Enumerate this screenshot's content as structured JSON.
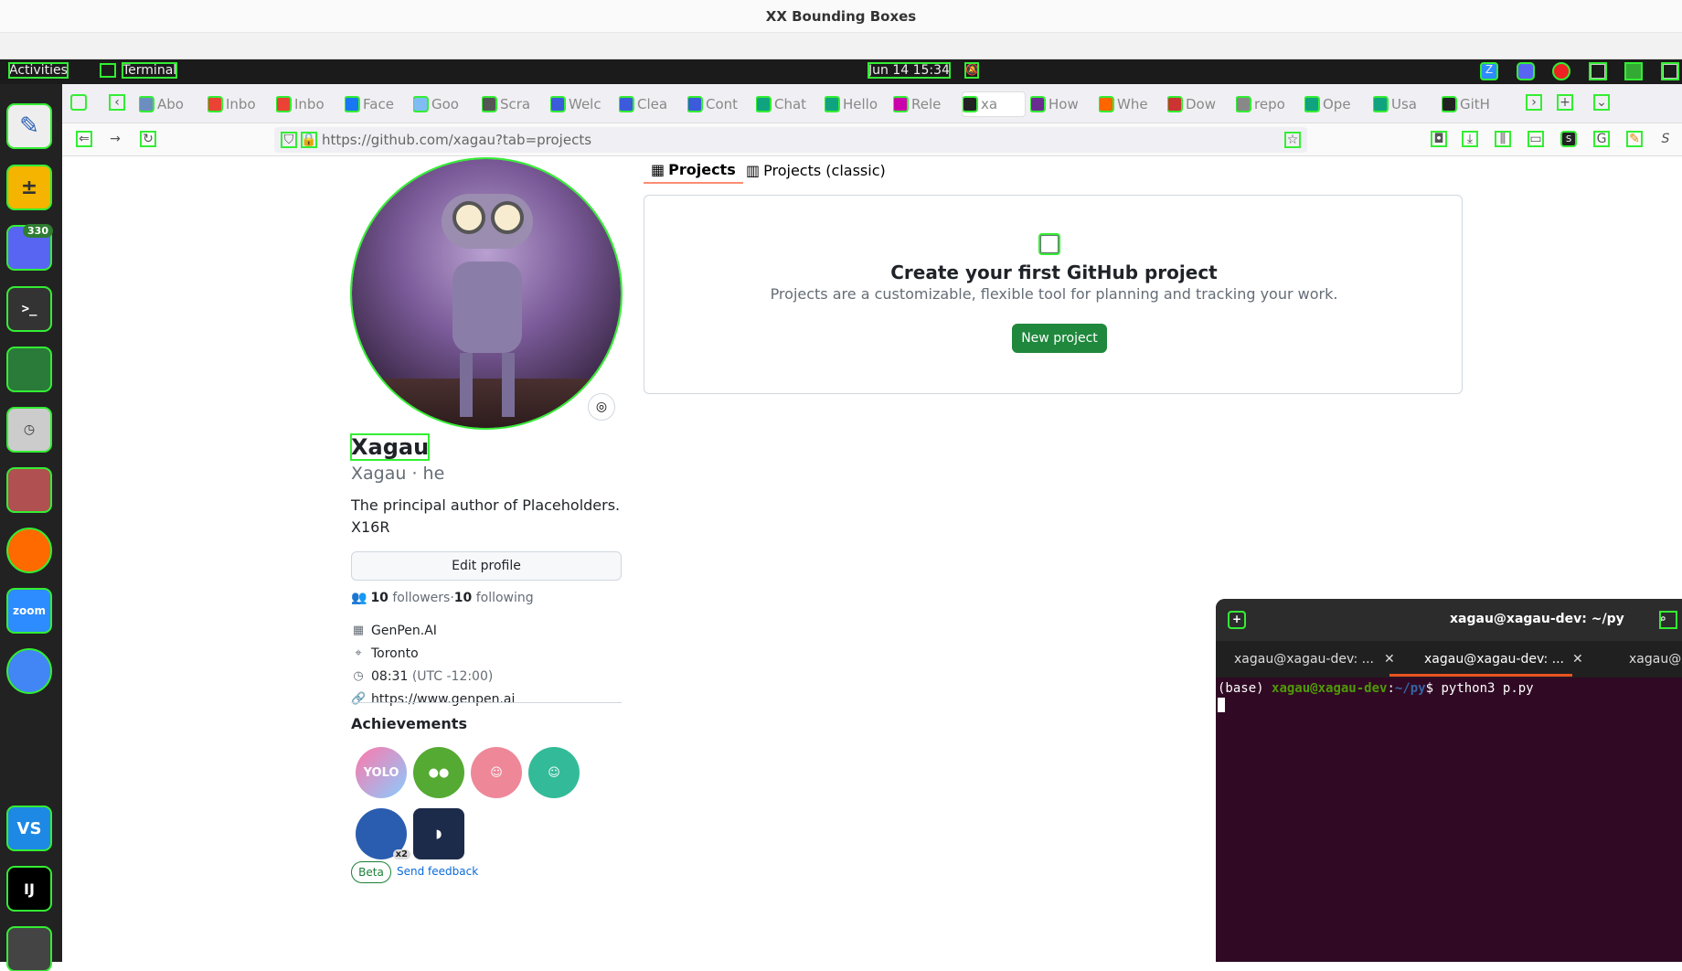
{
  "window": {
    "title": "XX Bounding Boxes"
  },
  "topbar": {
    "activities": "Activities",
    "app": "Terminal",
    "datetime": "Jun 14  15:34"
  },
  "dock": {
    "discord_badge": "330",
    "zoom": "zoom",
    "vs": "VS",
    "ij": "IJ"
  },
  "browser": {
    "tabs": [
      "Abo",
      "Inbo",
      "Inbo",
      "Face",
      "Goo",
      "Scra",
      "Welc",
      "Clea",
      "Cont",
      "Chat",
      "Hello",
      "Rele",
      "xa",
      "How",
      "Whe",
      "Dow",
      "repo",
      "Ope",
      "Usa",
      "GitH"
    ],
    "url": "https://github.com/xagau?tab=projects"
  },
  "profile": {
    "name": "Xagau",
    "login": "Xagau · he",
    "bio": "The principal author of Placeholders. X16R",
    "edit": "Edit profile",
    "followers_count": "10",
    "followers_label": "followers",
    "sep": " · ",
    "following_count": "10",
    "following_label": "following",
    "company": "GenPen.AI",
    "location": "Toronto",
    "time": "08:31",
    "tz": "(UTC -12:00)",
    "website": "https://www.genpen.ai",
    "achievements": "Achievements",
    "ach_x2": "x2",
    "beta": "Beta",
    "feedback": "Send feedback"
  },
  "projects": {
    "tab1": "Projects",
    "tab2": "Projects (classic)",
    "title": "Create your first GitHub project",
    "desc": "Projects are a customizable, flexible tool for planning and tracking your work.",
    "button": "New project"
  },
  "terminal": {
    "title": "xagau@xagau-dev: ~/py",
    "tab1": "xagau@xagau-dev: ...",
    "tab2": "xagau@xagau-dev: ...",
    "tab3": "xagau@x",
    "prompt_base": "(base) ",
    "prompt_user": "xagau@xagau-dev",
    "prompt_path": "~/py",
    "cmd": "$ python3 p.py"
  },
  "colors": {
    "accent": "#1f883d",
    "highlight": "#33ee33"
  }
}
